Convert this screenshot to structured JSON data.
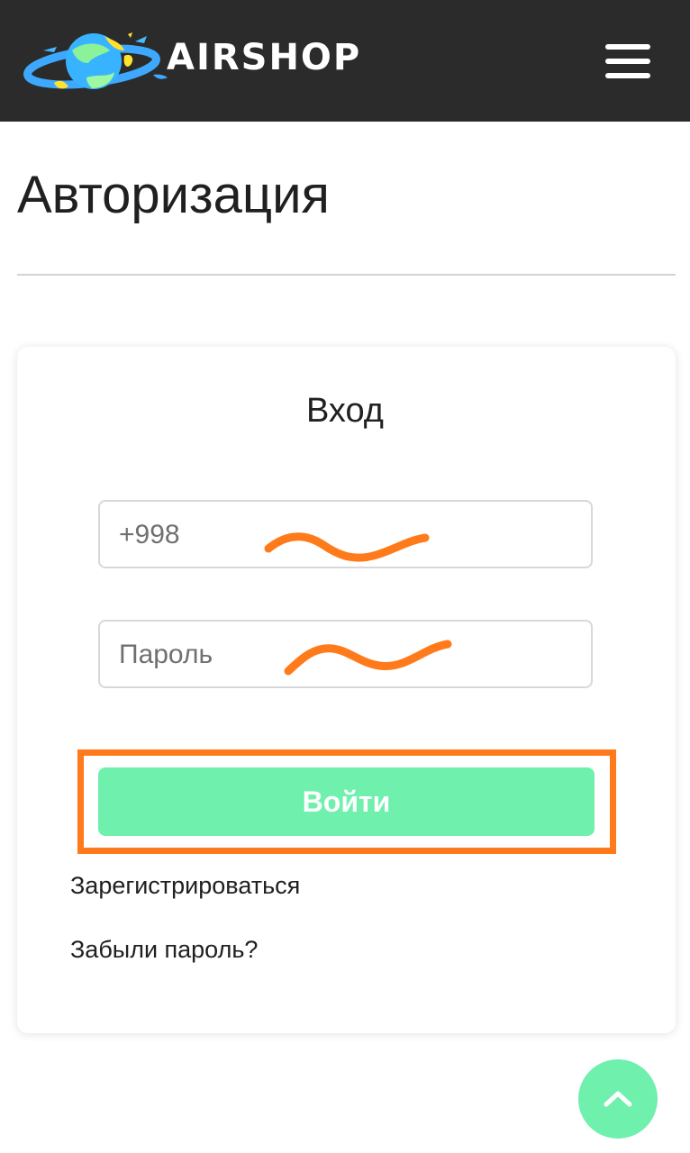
{
  "header": {
    "brand": "AIRSHOP",
    "logo_icon": "planet-logo-icon",
    "menu_icon": "hamburger-menu-icon",
    "background": "#2b2b2b"
  },
  "page": {
    "title": "Авторизация"
  },
  "login_card": {
    "title": "Вход",
    "phone_placeholder": "+998",
    "password_placeholder": "Пароль",
    "submit_label": "Войти",
    "register_link": "Зарегистрироваться",
    "forgot_link": "Забыли пароль?"
  },
  "colors": {
    "accent_green": "#6ff0ad",
    "annotation_orange": "#ff7a1a"
  },
  "scroll_top_icon": "chevron-up-icon"
}
